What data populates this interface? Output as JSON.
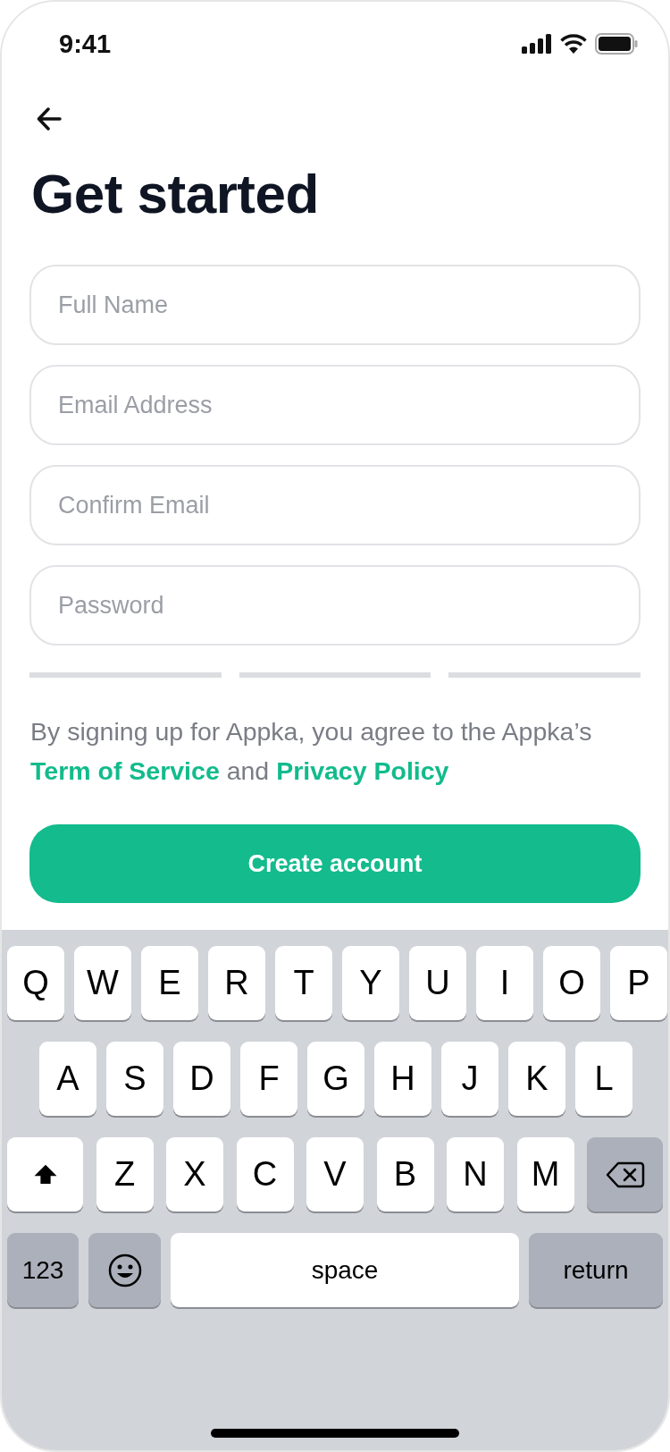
{
  "status_bar": {
    "time": "9:41"
  },
  "title": "Get started",
  "fields": [
    {
      "placeholder": "Full Name"
    },
    {
      "placeholder": "Email Address"
    },
    {
      "placeholder": "Confirm Email"
    },
    {
      "placeholder": "Password"
    }
  ],
  "terms": {
    "text": "By signing up for Appka, you agree to the Appka’s",
    "link_1": "Term of Service",
    "between": "and",
    "link_2": "Privacy Policy"
  },
  "create_button": "Create account",
  "keyboard": {
    "letter_rows": [
      [
        "Q",
        "W",
        "E",
        "R",
        "T",
        "Y",
        "U",
        "I",
        "O",
        "P"
      ],
      [
        "A",
        "S",
        "D",
        "F",
        "G",
        "H",
        "J",
        "K",
        "L"
      ],
      [
        "Z",
        "X",
        "C",
        "V",
        "B",
        "N",
        "M"
      ]
    ],
    "numbers_key": "123",
    "space_key": "space",
    "return_key": "return"
  }
}
